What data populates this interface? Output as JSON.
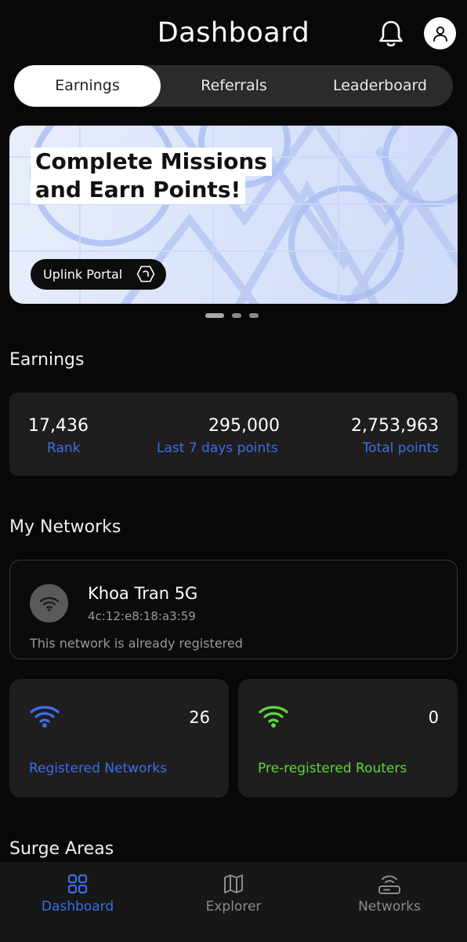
{
  "header": {
    "title": "Dashboard",
    "bell_icon": "bell-icon",
    "profile_icon": "user-icon"
  },
  "tabs": [
    {
      "label": "Earnings",
      "active": true
    },
    {
      "label": "Referrals",
      "active": false
    },
    {
      "label": "Leaderboard",
      "active": false
    }
  ],
  "banner": {
    "title_line1": "Complete Missions",
    "title_line2": "and Earn Points!",
    "button_label": "Uplink Portal",
    "button_icon": "hexagon-arrow-icon",
    "pages": 3,
    "active_page": 1
  },
  "earnings": {
    "section_title": "Earnings",
    "stats": [
      {
        "value": "17,436",
        "label": "Rank"
      },
      {
        "value": "295,000",
        "label": "Last 7 days points"
      },
      {
        "value": "2,753,963",
        "label": "Total points"
      }
    ]
  },
  "networks": {
    "section_title": "My Networks",
    "current": {
      "icon": "wifi-icon",
      "name": "Khoa Tran 5G",
      "mac": "4c:12:e8:18:a3:59",
      "note": "This network is already registered"
    },
    "registered": {
      "count": "26",
      "label": "Registered Networks",
      "color": "#3a6fe8"
    },
    "preregistered": {
      "count": "0",
      "label": "Pre-registered Routers",
      "color": "#5fd83a"
    }
  },
  "surge": {
    "section_title": "Surge Areas"
  },
  "bottom_nav": [
    {
      "label": "Dashboard",
      "icon": "grid-icon",
      "active": true
    },
    {
      "label": "Explorer",
      "icon": "map-icon",
      "active": false
    },
    {
      "label": "Networks",
      "icon": "router-icon",
      "active": false
    }
  ],
  "colors": {
    "accent_blue": "#3a6fe8",
    "accent_green": "#5fd83a",
    "background": "#080808",
    "card": "#1f1d1e"
  }
}
